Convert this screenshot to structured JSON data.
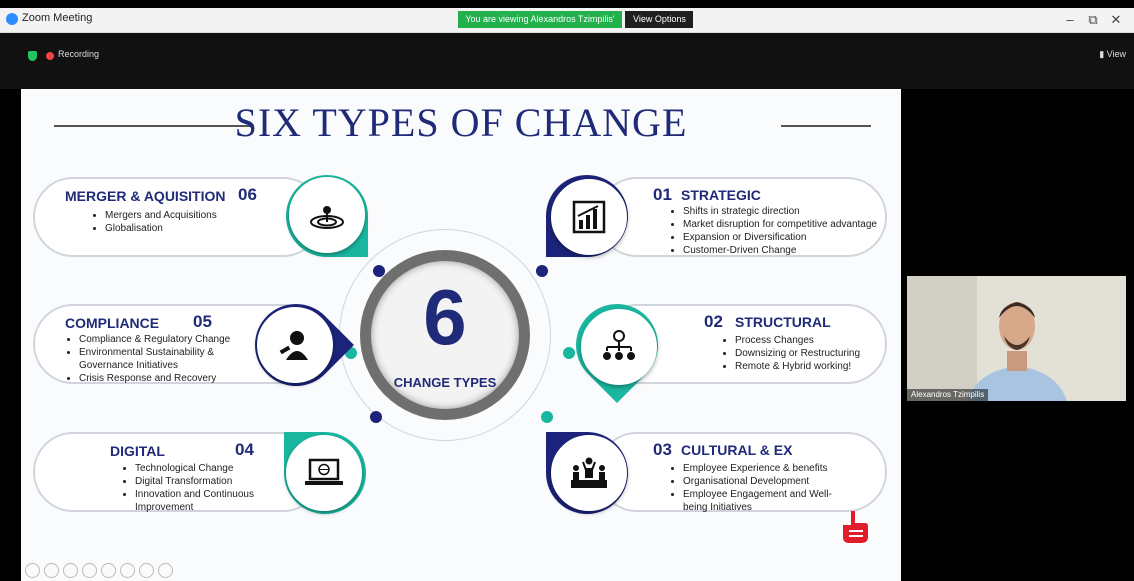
{
  "window": {
    "title": "Zoom Meeting",
    "share_banner": "You are viewing Alexandros Tzimpilis' screen",
    "view_options": "View Options",
    "recording": "Recording",
    "view": "View"
  },
  "slide": {
    "title": "SIX TYPES OF CHANGE",
    "center_number": "6",
    "center_label": "CHANGE TYPES",
    "cards": {
      "merger": {
        "title": "MERGER & AQUISITION",
        "number": "06",
        "items": [
          "Mergers and Acquisitions",
          "Globalisation"
        ]
      },
      "compliance": {
        "title": "COMPLIANCE",
        "number": "05",
        "items": [
          "Compliance & Regulatory Change",
          "Environmental Sustainability &",
          "Governance Initiatives",
          "Crisis Response and Recovery"
        ]
      },
      "digital": {
        "title": "DIGITAL",
        "number": "04",
        "items": [
          "Technological Change",
          "Digital Transformation",
          "Innovation and Continuous",
          "Improvement"
        ]
      },
      "strategic": {
        "title": "STRATEGIC",
        "number": "01",
        "items": [
          "Shifts in strategic direction",
          "Market disruption for competitive advantage",
          "Expansion or Diversification",
          "Customer-Driven Change"
        ]
      },
      "structural": {
        "title": "STRUCTURAL",
        "number": "02",
        "items": [
          "Process Changes",
          "Downsizing or Restructuring",
          "Remote & Hybrid working!"
        ]
      },
      "cultural": {
        "title": "CULTURAL & EX",
        "number": "03",
        "items": [
          "Employee Experience & benefits",
          "Organisational Development",
          "Employee Engagement and Well-",
          "being Initiatives"
        ]
      }
    }
  },
  "participant": {
    "name": "Alexandros Tzimpilis"
  },
  "colors": {
    "navy": "#1c237a",
    "teal": "#1ab7a0",
    "zoom_green": "#22b14c"
  }
}
